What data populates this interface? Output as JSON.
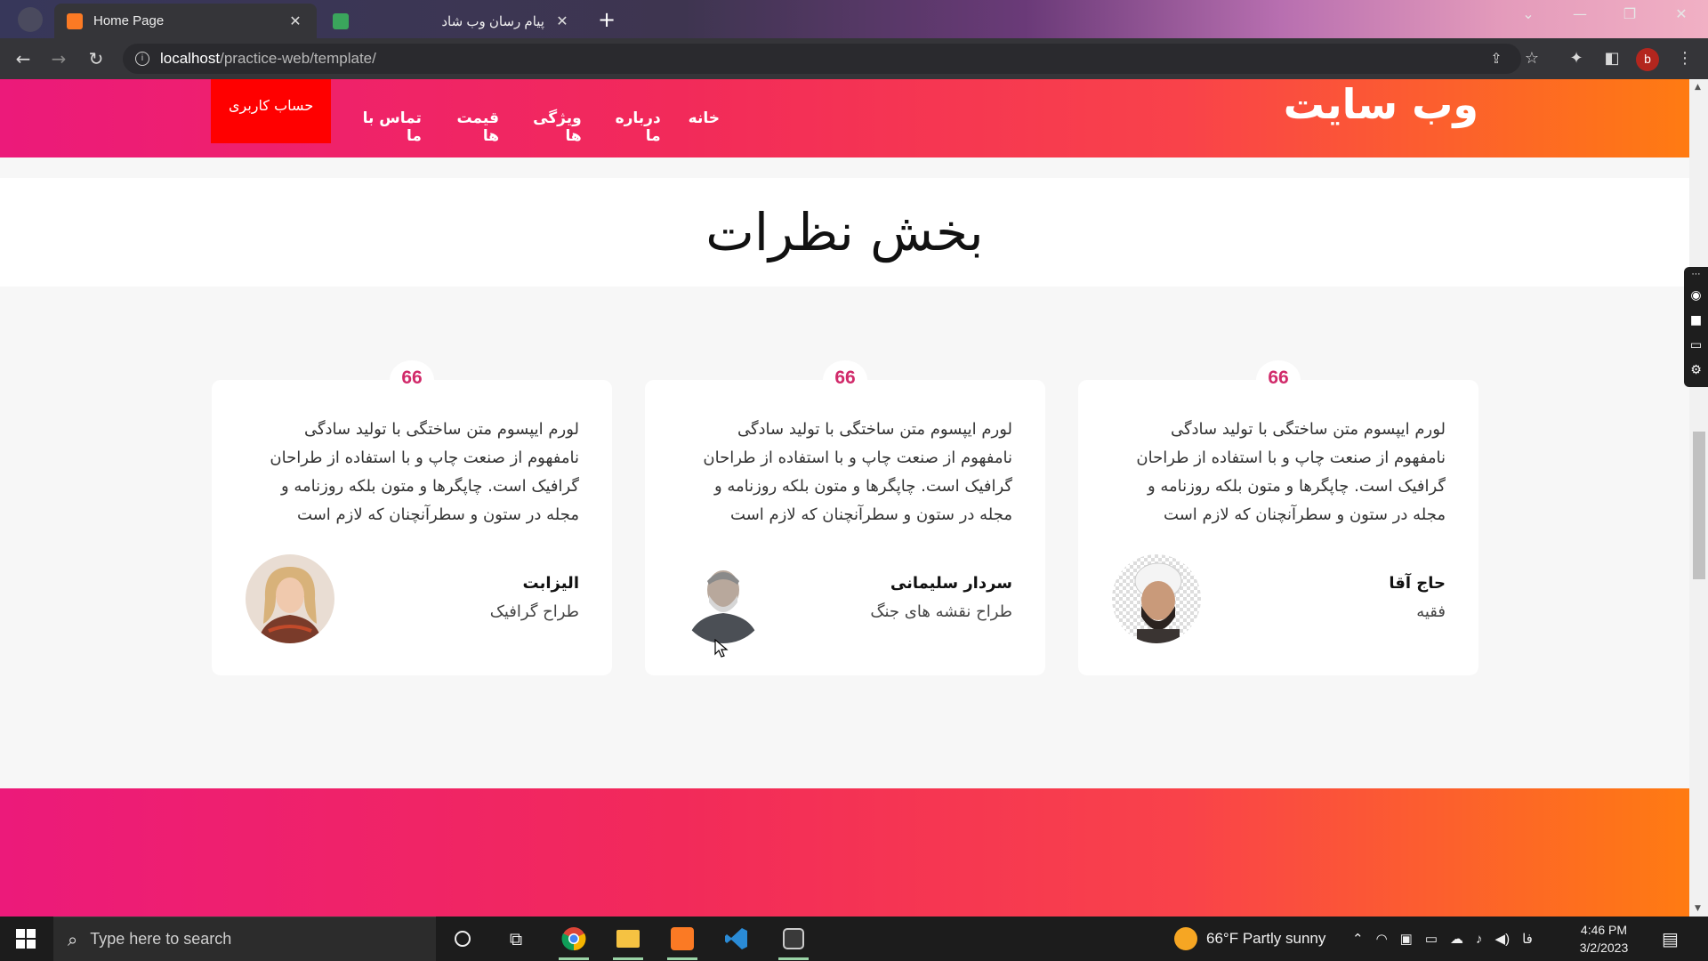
{
  "browser": {
    "tabs": [
      {
        "title": "Home Page",
        "active": true,
        "favicon_color": "#fb7a24"
      },
      {
        "title": "پیام رسان وب شاد",
        "active": false,
        "favicon_color": "#3aa55c"
      }
    ],
    "new_tab_symbol": "+",
    "close_symbol": "✕",
    "url": {
      "host": "localhost",
      "path": "/practice-web/template/"
    },
    "profile_letter": "b"
  },
  "site": {
    "logo": "وب سایت",
    "account_button": "حساب کاربری",
    "nav": [
      "خانه",
      "درباره ما",
      "ویژگی ها",
      "قیمت ها",
      "تماس با ما"
    ],
    "section_title": "بخش نظرات",
    "quote_mark": "66",
    "testimonials": [
      {
        "text": "لورم ایپسوم متن ساختگی با تولید سادگی نامفهوم از صنعت چاپ و با استفاده از طراحان گرافیک است. چاپگرها و متون بلکه روزنامه و مجله در ستون و سطرآنچنان که لازم است",
        "name": "حاج آقا",
        "role": "فقیه",
        "photo_icon": "cleric-portrait-icon"
      },
      {
        "text": "لورم ایپسوم متن ساختگی با تولید سادگی نامفهوم از صنعت چاپ و با استفاده از طراحان گرافیک است. چاپگرها و متون بلکه روزنامه و مجله در ستون و سطرآنچنان که لازم است",
        "name": "سردار سلیمانی",
        "role": "طراح نقشه های جنگ",
        "photo_icon": "general-portrait-icon"
      },
      {
        "text": "لورم ایپسوم متن ساختگی با تولید سادگی نامفهوم از صنعت چاپ و با استفاده از طراحان گرافیک است. چاپگرها و متون بلکه روزنامه و مجله در ستون و سطرآنچنان که لازم است",
        "name": "الیزابت",
        "role": "طراح گرافیک",
        "photo_icon": "woman-portrait-icon"
      }
    ],
    "colors": {
      "gradient_start": "#ec1a7a",
      "gradient_end": "#ff7b12",
      "account_bg": "#ff0000",
      "quote": "#d12a6a"
    }
  },
  "taskbar": {
    "search_placeholder": "Type here to search",
    "weather": "66°F  Partly sunny",
    "language": "فا",
    "time": "4:46 PM",
    "date": "3/2/2023"
  }
}
